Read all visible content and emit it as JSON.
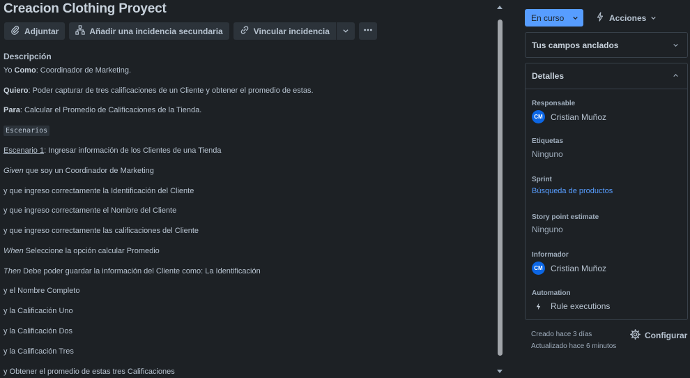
{
  "issue": {
    "title": "Creacion Clothing Proyect"
  },
  "toolbar": {
    "attach_label": "Adjuntar",
    "add_child_label": "Añadir una incidencia secundaria",
    "link_label": "Vincular incidencia"
  },
  "description": {
    "heading": "Descripción",
    "lines": [
      {
        "prefix": "Yo ",
        "bold": "Como",
        "rest": ": Coordinador de Marketing."
      },
      {
        "bold": "Quiero",
        "rest": ": Poder capturar de tres calificaciones de un Cliente y obtener el promedio de estas."
      },
      {
        "bold": "Para",
        "rest": ": Calcular el Promedio de Calificaciones de la Tienda."
      },
      {
        "code": "Escenarios"
      },
      {
        "underline": "Escenario 1",
        "rest": ": Ingresar información de los Clientes de una Tienda"
      },
      {
        "italic": "Given",
        "rest": " que soy un Coordinador de Marketing"
      },
      {
        "rest": "y que ingreso correctamente la Identificación del Cliente"
      },
      {
        "rest": "y que ingreso correctamente el Nombre del Cliente"
      },
      {
        "rest": "y que ingreso correctamente las calificaciones del Cliente"
      },
      {
        "italic": "When",
        "rest": " Seleccione la opción calcular Promedio"
      },
      {
        "italic": "Then",
        "rest": " Debe poder guardar la información del Cliente como: La Identificación"
      },
      {
        "rest": "y el Nombre Completo"
      },
      {
        "rest": "y la Calificación Uno"
      },
      {
        "rest": "y la Calificación Dos"
      },
      {
        "rest": "y la Calificación Tres"
      },
      {
        "rest": "y Obtener el promedio de estas tres Calificaciones"
      }
    ]
  },
  "sidebar": {
    "status_label": "En curso",
    "actions_label": "Acciones",
    "pinned_title": "Tus campos anclados",
    "details_title": "Detalles",
    "fields": {
      "assignee_label": "Responsable",
      "assignee_initials": "CM",
      "assignee_name": "Cristian Muñoz",
      "labels_label": "Etiquetas",
      "labels_value": "Ninguno",
      "sprint_label": "Sprint",
      "sprint_value": "Búsqueda de productos",
      "story_points_label": "Story point estimate",
      "story_points_value": "Ninguno",
      "reporter_label": "Informador",
      "reporter_initials": "CM",
      "reporter_name": "Cristian Muñoz",
      "automation_label": "Automation",
      "automation_value": "Rule executions"
    },
    "created": "Creado hace 3 días",
    "updated": "Actualizado hace 6 minutos",
    "configure_label": "Configurar"
  },
  "colors": {
    "background": "#1d2125",
    "accent": "#579dff",
    "avatar": "#0c66e4"
  }
}
